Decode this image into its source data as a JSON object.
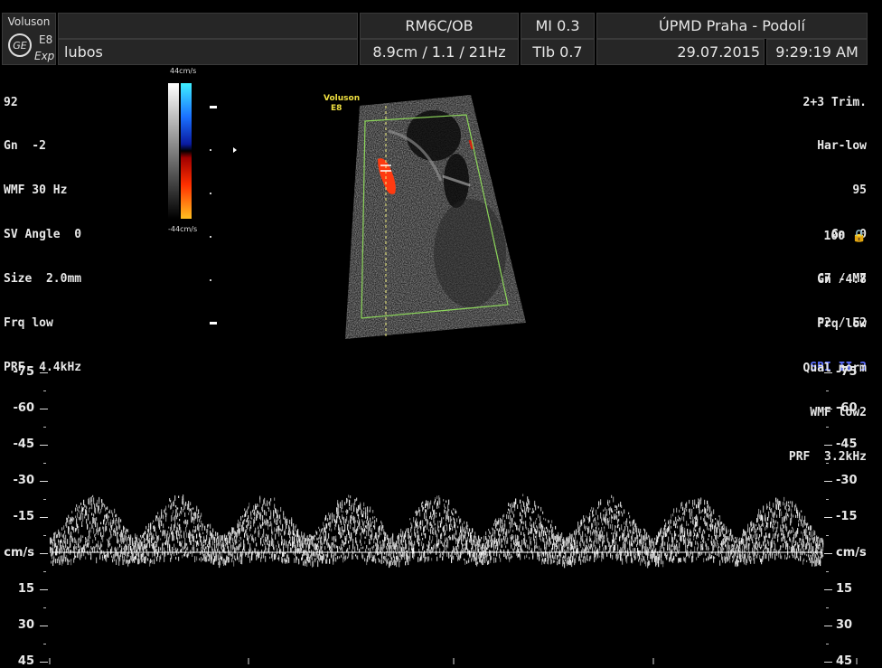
{
  "header": {
    "brand": "Voluson",
    "model": "E8",
    "edition": "Exp",
    "logo": "GE",
    "patient": "lubos",
    "probe": "RM6C/OB",
    "mi": "MI  0.3",
    "institution": "ÚPMD Praha - Podolí",
    "depth_info": "8.9cm / 1.1 / 21Hz",
    "tib": "TIb  0.7",
    "date": "29.07.2015",
    "time": "9:29:19 AM"
  },
  "left_params": [
    "92",
    "Gn  -2",
    "WMF 30 Hz",
    "SV Angle  0",
    "Size  2.0mm",
    "Frq low",
    "PRF  4.4kHz"
  ],
  "right_params": [
    "2+3 Trim.",
    "Har-low",
    "95",
    "Gn  0",
    "C7 / M7",
    "P2 / E2"
  ],
  "right_sri": "SRI II 3",
  "right_params2": [
    "100 🔒",
    "Gn -4.8",
    "Frq low",
    "Qual norm",
    "WMF low2",
    "PRF  3.2kHz"
  ],
  "colorbar": {
    "top": "44cm/s",
    "bottom": "-44cm/s"
  },
  "image_mark": {
    "brand": "Voluson",
    "model": "E8"
  },
  "doppler": {
    "scale_labels": [
      "-75",
      "-60",
      "-45",
      "-30",
      "-15",
      "cm/s",
      "15",
      "30",
      "45"
    ],
    "cycles": 9
  },
  "colors": {
    "gate_box": "#8cd65a",
    "accent_blue": "#5a6cff",
    "flow_red": "#ff3a10"
  }
}
